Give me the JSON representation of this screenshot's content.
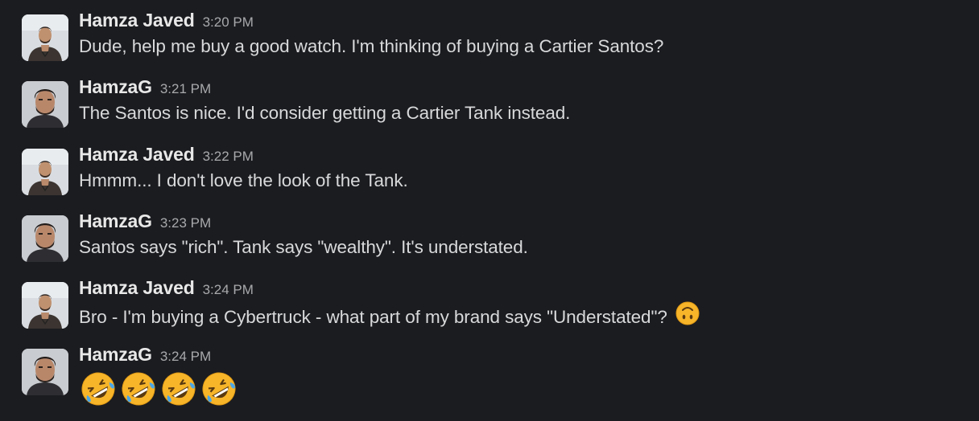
{
  "messages": [
    {
      "author": "Hamza Javed",
      "avatar": "avatar-hamza-javed",
      "time": "3:20 PM",
      "text": "Dude, help me buy a good watch. I'm thinking of buying a Cartier Santos?"
    },
    {
      "author": "HamzaG",
      "avatar": "avatar-hamzag",
      "time": "3:21 PM",
      "text": "The Santos is nice. I'd consider getting a Cartier Tank instead."
    },
    {
      "author": "Hamza Javed",
      "avatar": "avatar-hamza-javed",
      "time": "3:22 PM",
      "text": "Hmmm... I don't love the look of the Tank."
    },
    {
      "author": "HamzaG",
      "avatar": "avatar-hamzag",
      "time": "3:23 PM",
      "text": "Santos says \"rich\". Tank says \"wealthy\". It's understated."
    },
    {
      "author": "Hamza Javed",
      "avatar": "avatar-hamza-javed",
      "time": "3:24 PM",
      "text": "Bro - I'm buying a Cybertruck - what part of my brand says \"Understated\"?",
      "trailing_emoji": "upside-down-face-emoji"
    },
    {
      "author": "HamzaG",
      "avatar": "avatar-hamzag",
      "time": "3:24 PM",
      "text": "",
      "emojis": [
        "rolling-on-floor-laughing-emoji",
        "rolling-on-floor-laughing-emoji",
        "rolling-on-floor-laughing-emoji",
        "rolling-on-floor-laughing-emoji"
      ]
    }
  ],
  "colors": {
    "background": "#1b1c20",
    "name": "#e8e8e8",
    "timestamp": "#a8a9ab",
    "message_text": "#d8d9da",
    "emoji_yellow": "#f7b52a"
  }
}
